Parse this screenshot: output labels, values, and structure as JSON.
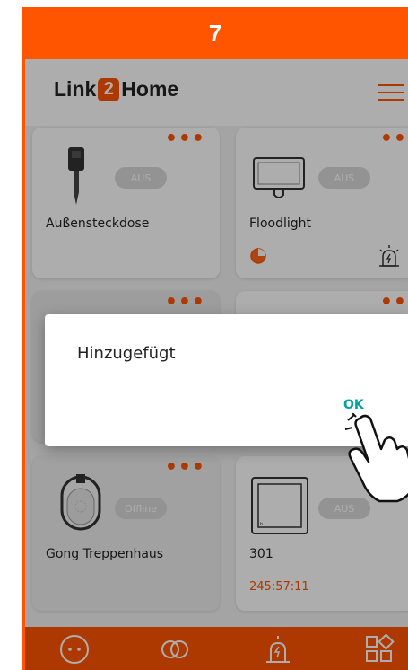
{
  "step_number": "7",
  "app": {
    "logo_text_left": "Link",
    "logo_text_mid": "2",
    "logo_text_right": "Home"
  },
  "devices": [
    {
      "name": "Außensteckdose",
      "toggle": "AUS"
    },
    {
      "name": "Floodlight",
      "toggle": "AUS"
    },
    {
      "name": "Gong Treppenhaus",
      "toggle": "Offline"
    },
    {
      "name": "301",
      "toggle": "AUS",
      "timer": "245:57:11"
    }
  ],
  "dialog": {
    "message": "Hinzugefügt",
    "ok_label": "OK"
  },
  "colors": {
    "accent": "#ff5500",
    "ok": "#00a3a3"
  },
  "bottom_nav": [
    "devices-icon",
    "link-icon",
    "alarm-icon",
    "apps-icon"
  ]
}
